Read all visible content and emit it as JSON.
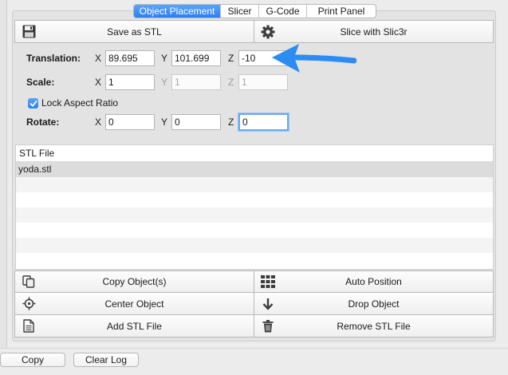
{
  "tabs": [
    {
      "label": "Object Placement",
      "active": true
    },
    {
      "label": "Slicer",
      "active": false
    },
    {
      "label": "G-Code",
      "active": false
    },
    {
      "label": "Print Panel",
      "active": false
    }
  ],
  "toolbar": {
    "save_stl": {
      "label": "Save as STL",
      "icon": "floppy-disk-icon"
    },
    "slice": {
      "label": "Slice with Slic3r",
      "icon": "gear-icon"
    }
  },
  "placement": {
    "translation": {
      "label": "Translation:",
      "x_axis": "X",
      "y_axis": "Y",
      "z_axis": "Z",
      "x": "89.695",
      "y": "101.699",
      "z": "-10"
    },
    "scale": {
      "label": "Scale:",
      "x_axis": "X",
      "y_axis": "Y",
      "z_axis": "Z",
      "x": "1",
      "y": "1",
      "z": "1"
    },
    "lock_aspect": {
      "label": "Lock Aspect Ratio",
      "checked": true
    },
    "rotate": {
      "label": "Rotate:",
      "x_axis": "X",
      "y_axis": "Y",
      "z_axis": "Z",
      "x": "0",
      "y": "0",
      "z": "0"
    }
  },
  "stl_table": {
    "header": "STL File",
    "rows": [
      "yoda.stl"
    ]
  },
  "actions": {
    "copy_objects": {
      "label": "Copy Object(s)",
      "icon": "copy-icon"
    },
    "auto_position": {
      "label": "Auto Position",
      "icon": "grid-icon"
    },
    "center_object": {
      "label": "Center Object",
      "icon": "crosshair-icon"
    },
    "drop_object": {
      "label": "Drop Object",
      "icon": "arrow-down-icon"
    },
    "add_stl": {
      "label": "Add STL File",
      "icon": "document-icon"
    },
    "remove_stl": {
      "label": "Remove STL File",
      "icon": "trash-icon"
    }
  },
  "log": {
    "copy_label": "Copy",
    "clear_label": "Clear Log"
  },
  "colors": {
    "accent": "#2a7ff3",
    "annotation_arrow": "#2d8cf0"
  }
}
